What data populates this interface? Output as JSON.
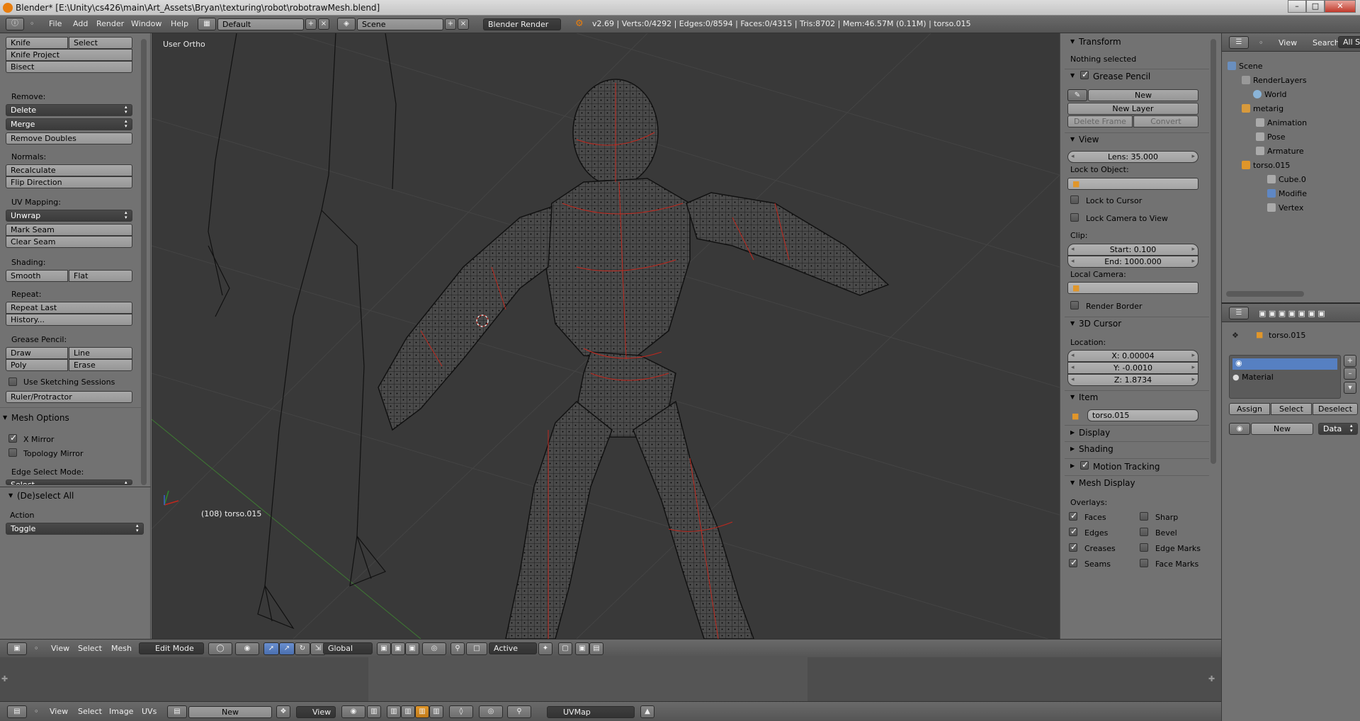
{
  "window": {
    "title": "Blender* [E:\\Unity\\cs426\\main\\Art_Assets\\Bryan\\texturing\\robot\\robotrawMesh.blend]"
  },
  "topbar": {
    "menus": [
      "File",
      "Add",
      "Render",
      "Window",
      "Help"
    ],
    "screen": "Default",
    "scene": "Scene",
    "engine": "Blender Render",
    "stats": "v2.69 | Verts:0/4292 | Edges:0/8594 | Faces:0/4315 | Tris:8702 | Mem:46.57M (0.11M) | torso.015"
  },
  "tools": {
    "knife": "Knife",
    "select": "Select",
    "knife_project": "Knife Project",
    "bisect": "Bisect",
    "remove_label": "Remove:",
    "delete": "Delete",
    "merge": "Merge",
    "remove_doubles": "Remove Doubles",
    "normals_label": "Normals:",
    "recalculate": "Recalculate",
    "flip_direction": "Flip Direction",
    "uv_label": "UV Mapping:",
    "unwrap": "Unwrap",
    "mark_seam": "Mark Seam",
    "clear_seam": "Clear Seam",
    "shading_label": "Shading:",
    "smooth": "Smooth",
    "flat": "Flat",
    "repeat_label": "Repeat:",
    "repeat_last": "Repeat Last",
    "history": "History...",
    "gp_label": "Grease Pencil:",
    "draw": "Draw",
    "line": "Line",
    "poly": "Poly",
    "erase": "Erase",
    "sketching": "Use Sketching Sessions",
    "ruler": "Ruler/Protractor",
    "mesh_options": "Mesh Options",
    "x_mirror": "X Mirror",
    "topology_mirror": "Topology Mirror",
    "edge_select_mode": "Edge Select Mode:",
    "edge_select_value": "Select",
    "deselect_all": "(De)select All",
    "action_label": "Action",
    "action_value": "Toggle"
  },
  "viewport": {
    "view_name": "User Ortho",
    "object_info": "(108) torso.015"
  },
  "props": {
    "transform": "Transform",
    "nothing_selected": "Nothing selected",
    "grease_pencil": "Grease Pencil",
    "new": "New",
    "new_layer": "New Layer",
    "delete_frame": "Delete Frame",
    "convert": "Convert",
    "view": "View",
    "lens": "Lens: 35.000",
    "lock_to_object": "Lock to Object:",
    "lock_to_cursor": "Lock to Cursor",
    "lock_camera": "Lock Camera to View",
    "clip": "Clip:",
    "clip_start": "Start: 0.100",
    "clip_end": "End: 1000.000",
    "local_camera": "Local Camera:",
    "render_border": "Render Border",
    "cursor": "3D Cursor",
    "location": "Location:",
    "x": "X: 0.00004",
    "y": "Y: -0.0010",
    "z": "Z: 1.8734",
    "item": "Item",
    "item_name": "torso.015",
    "display": "Display",
    "shading": "Shading",
    "motion_tracking": "Motion Tracking",
    "mesh_display": "Mesh Display",
    "overlays": "Overlays:",
    "faces": "Faces",
    "sharp": "Sharp",
    "edges": "Edges",
    "bevel": "Bevel",
    "creases": "Creases",
    "edge_marks": "Edge Marks",
    "seams": "Seams",
    "face_marks": "Face Marks"
  },
  "outliner": {
    "view": "View",
    "search": "Search",
    "all_scenes": "All Sc",
    "items": [
      "Scene",
      "RenderLayers",
      "World",
      "metarig",
      "Animation",
      "Pose",
      "Armature",
      "torso.015",
      "Cube.0",
      "Modifie",
      "Vertex"
    ]
  },
  "material": {
    "object": "torso.015",
    "slot": "Material",
    "assign": "Assign",
    "select": "Select",
    "deselect": "Deselect",
    "new": "New",
    "data": "Data"
  },
  "vp_header": {
    "view": "View",
    "select": "Select",
    "mesh": "Mesh",
    "mode": "Edit Mode",
    "orientation": "Global",
    "pivot": "Active"
  },
  "uv_header": {
    "view": "View",
    "select": "Select",
    "image": "Image",
    "uvs": "UVs",
    "new": "New",
    "view2": "View",
    "uvmap": "UVMap"
  },
  "colors": {
    "wire": "#000000",
    "seam": "#c0281e",
    "panel": "#727272",
    "viewport": "#393939",
    "highlight": "#5680c2"
  }
}
